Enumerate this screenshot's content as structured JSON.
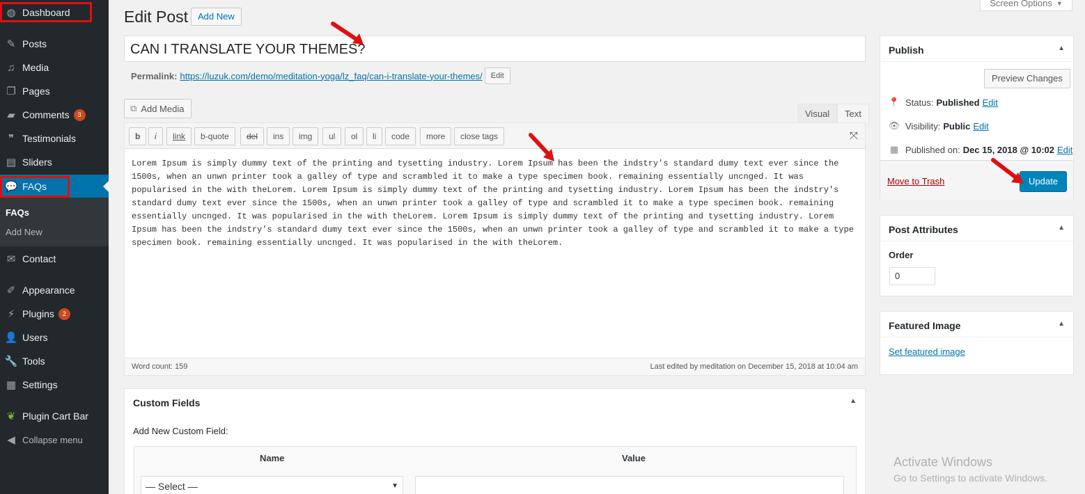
{
  "sidebar": {
    "items": [
      {
        "label": "Dashboard",
        "icon": "dashboard-icon"
      },
      {
        "label": "Posts",
        "icon": "pin-icon"
      },
      {
        "label": "Media",
        "icon": "media-icon"
      },
      {
        "label": "Pages",
        "icon": "pages-icon"
      },
      {
        "label": "Comments",
        "icon": "comments-icon",
        "count": "3"
      },
      {
        "label": "Testimonials",
        "icon": "testimonials-icon"
      },
      {
        "label": "Sliders",
        "icon": "sliders-icon"
      },
      {
        "label": "FAQs",
        "icon": "faq-icon"
      },
      {
        "label": "Contact",
        "icon": "mail-icon"
      },
      {
        "label": "Appearance",
        "icon": "brush-icon"
      },
      {
        "label": "Plugins",
        "icon": "plugin-icon",
        "count": "2"
      },
      {
        "label": "Users",
        "icon": "user-icon"
      },
      {
        "label": "Tools",
        "icon": "wrench-icon"
      },
      {
        "label": "Settings",
        "icon": "settings-icon"
      },
      {
        "label": "Plugin Cart Bar",
        "icon": "leaf-icon"
      },
      {
        "label": "Collapse menu",
        "icon": "collapse-icon"
      }
    ],
    "submenu": [
      "FAQs",
      "Add New"
    ]
  },
  "header": {
    "title": "Edit Post",
    "add_new": "Add New",
    "screen_options": "Screen Options"
  },
  "post": {
    "title": "CAN I TRANSLATE YOUR THEMES?",
    "permalink_label": "Permalink:",
    "permalink_base": "https://luzuk.com/demo/meditation-yoga/lz_faq/",
    "permalink_slug": "can-i-translate-your-themes",
    "permalink_end": "/",
    "edit_label": "Edit"
  },
  "editor": {
    "add_media": "Add Media",
    "tabs": [
      "Visual",
      "Text"
    ],
    "active_tab": "Text",
    "quicktags": [
      "b",
      "i",
      "link",
      "b-quote",
      "del",
      "ins",
      "img",
      "ul",
      "ol",
      "li",
      "code",
      "more",
      "close tags"
    ],
    "content": "Lorem Ipsum is simply dummy text of the printing and tysetting industry. Lorem Ipsum has been the indstry's standard dumy text ever since the 1500s, when an unwn printer took a galley of type and scrambled it to make a type specimen book. remaining essentially uncnged. It was popularised in the with theLorem. Lorem Ipsum is simply dummy text of the printing and tysetting industry. Lorem Ipsum has been the indstry's standard dumy text ever since the 1500s, when an unwn printer took a galley of type and scrambled it to make a type specimen book. remaining essentially uncnged. It was popularised in the with theLorem. Lorem Ipsum is simply dummy text of the printing and tysetting industry. Lorem Ipsum has been the indstry's standard dumy text ever since the 1500s, when an unwn printer took a galley of type and scrambled it to make a type specimen book. remaining essentially uncnged. It was popularised in the with theLorem.",
    "word_count": "Word count: 159",
    "last_edited": "Last edited by meditation on December 15, 2018 at 10:04 am"
  },
  "custom_fields": {
    "title": "Custom Fields",
    "subtitle": "Add New Custom Field:",
    "col_name": "Name",
    "col_value": "Value",
    "select_value": "— Select —"
  },
  "publish": {
    "title": "Publish",
    "preview": "Preview Changes",
    "status_label": "Status:",
    "status_value": "Published",
    "visibility_label": "Visibility:",
    "visibility_value": "Public",
    "published_label": "Published on:",
    "published_value": "Dec 15, 2018 @ 10:02",
    "edit": "Edit",
    "trash": "Move to Trash",
    "update": "Update"
  },
  "attributes": {
    "title": "Post Attributes",
    "order_label": "Order",
    "order_value": "0"
  },
  "featured": {
    "title": "Featured Image",
    "link": "Set featured image"
  },
  "watermark": {
    "title": "Activate Windows",
    "subtitle": "Go to Settings to activate Windows."
  },
  "colors": {
    "sidebar_bg": "#23282d",
    "accent": "#0073aa",
    "badge": "#ca4a1f",
    "annotation": "#e01010"
  }
}
